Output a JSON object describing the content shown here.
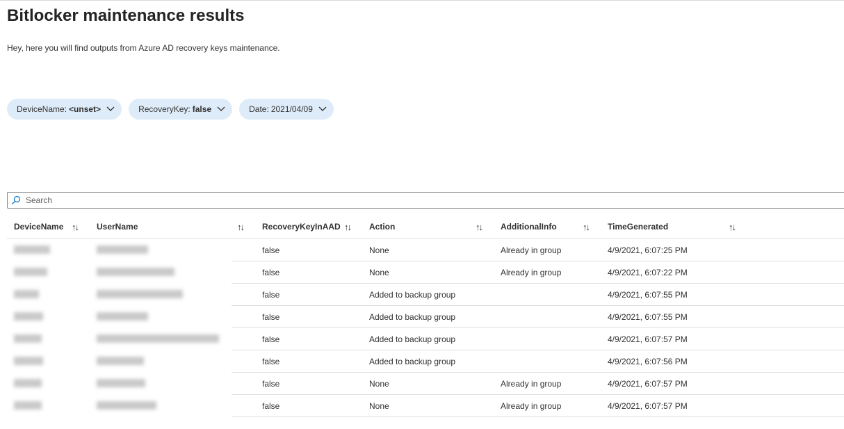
{
  "page": {
    "title": "Bitlocker maintenance results",
    "description": "Hey, here you will find outputs from Azure AD recovery keys maintenance."
  },
  "filters": [
    {
      "label": "DeviceName:",
      "value": "<unset>"
    },
    {
      "label": "RecoveryKey:",
      "value": "false"
    },
    {
      "label": "Date:",
      "value": "2021/04/09"
    }
  ],
  "search": {
    "placeholder": "Search",
    "value": "",
    "icon": "search-icon"
  },
  "table": {
    "columns": [
      "DeviceName",
      "UserName",
      "RecoveryKeyInAAD",
      "Action",
      "AdditionalInfo",
      "TimeGenerated"
    ],
    "sort_icon": "↑↓",
    "rows": [
      {
        "recovery": "false",
        "action": "None",
        "info": "Already in group",
        "time": "4/9/2021, 6:07:25 PM"
      },
      {
        "recovery": "false",
        "action": "None",
        "info": "Already in group",
        "time": "4/9/2021, 6:07:22 PM"
      },
      {
        "recovery": "false",
        "action": "Added to backup group",
        "info": "",
        "time": "4/9/2021, 6:07:55 PM"
      },
      {
        "recovery": "false",
        "action": "Added to backup group",
        "info": "",
        "time": "4/9/2021, 6:07:55 PM"
      },
      {
        "recovery": "false",
        "action": "Added to backup group",
        "info": "",
        "time": "4/9/2021, 6:07:57 PM"
      },
      {
        "recovery": "false",
        "action": "Added to backup group",
        "info": "",
        "time": "4/9/2021, 6:07:56 PM"
      },
      {
        "recovery": "false",
        "action": "None",
        "info": "Already in group",
        "time": "4/9/2021, 6:07:57 PM"
      },
      {
        "recovery": "false",
        "action": "None",
        "info": "Already in group",
        "time": "4/9/2021, 6:07:57 PM"
      }
    ]
  },
  "colors": {
    "pill_bg": "#deecf9",
    "border": "#e1dfdd",
    "accent": "#0078d4"
  }
}
